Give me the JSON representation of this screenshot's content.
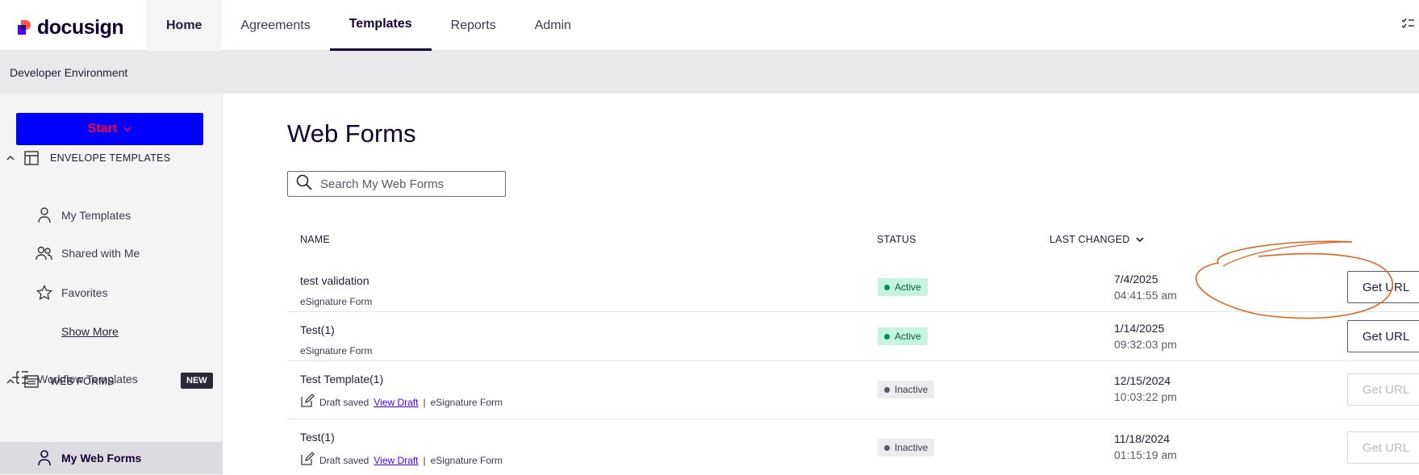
{
  "app": {
    "logo_text": "docusign"
  },
  "nav": {
    "items": [
      {
        "label": "Home"
      },
      {
        "label": "Agreements"
      },
      {
        "label": "Templates"
      },
      {
        "label": "Reports"
      },
      {
        "label": "Admin"
      }
    ],
    "active": "Templates",
    "right_icon": "checklist-icon"
  },
  "env_banner": "Developer Environment",
  "sidebar": {
    "start_label": "Start",
    "envelope_section": "ENVELOPE TEMPLATES",
    "items": [
      {
        "label": "My Templates",
        "icon": "person-icon"
      },
      {
        "label": "Shared with Me",
        "icon": "people-icon"
      },
      {
        "label": "Favorites",
        "icon": "star-icon"
      }
    ],
    "show_more": "Show More",
    "workflow_label": "Workflow Templates",
    "new_badge": "NEW",
    "webforms_section": "WEB FORMS",
    "my_web_forms": "My Web Forms"
  },
  "main": {
    "title": "Web Forms",
    "search_placeholder": "Search My Web Forms",
    "columns": {
      "name": "NAME",
      "status": "STATUS",
      "last_changed": "LAST CHANGED"
    },
    "rows": [
      {
        "name": "test validation",
        "type": "eSignature Form",
        "status": "Active",
        "date": "7/4/2025",
        "time": "04:41:55 am",
        "button": "Get URL",
        "enabled": true
      },
      {
        "name": "Test(1)",
        "type": "eSignature Form",
        "status": "Active",
        "date": "1/14/2025",
        "time": "09:32:03 pm",
        "button": "Get URL",
        "enabled": true
      },
      {
        "name": "Test Template(1)",
        "draft": "Draft saved",
        "view_draft": "View Draft",
        "sep": "|",
        "type": "eSignature Form",
        "status": "Inactive",
        "date": "12/15/2024",
        "time": "10:03:22 pm",
        "button": "Get URL",
        "enabled": false
      },
      {
        "name": "Test(1)",
        "draft": "Draft saved",
        "view_draft": "View Draft",
        "sep": "|",
        "type": "eSignature Form",
        "status": "Inactive",
        "date": "11/18/2024",
        "time": "01:15:19 am",
        "button": "Get URL",
        "enabled": false
      }
    ]
  },
  "colors": {
    "accent": "#4c00ff",
    "start_button_bg": "#0000ff",
    "start_button_text": "#ff0033",
    "annotation": "#e2621b"
  }
}
